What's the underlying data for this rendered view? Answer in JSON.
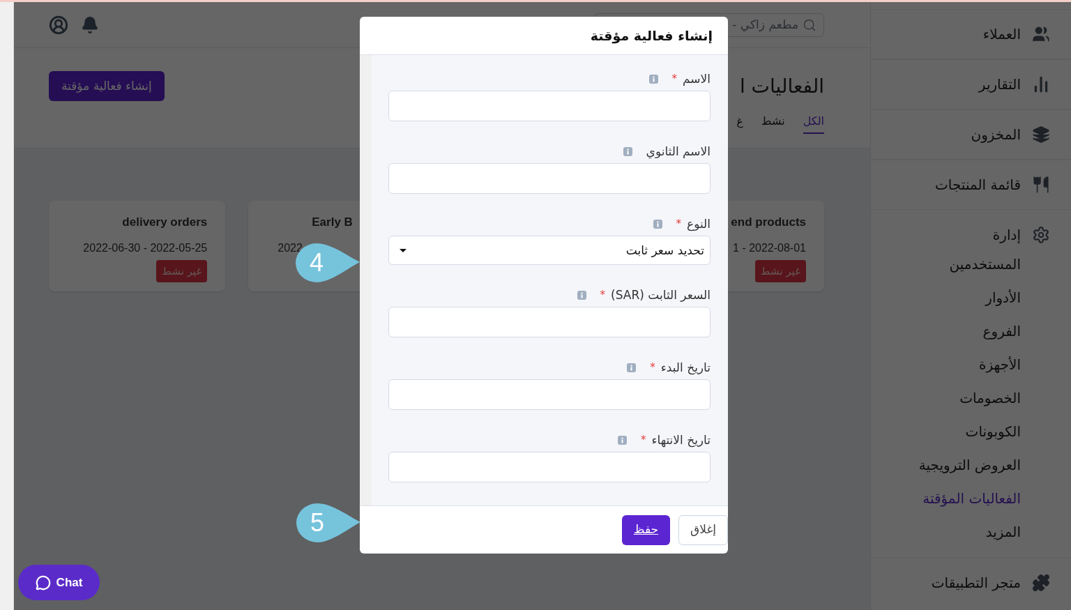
{
  "topbar": {
    "search_text": "مطعم زاكي -"
  },
  "header": {
    "title": "الفعاليات ا",
    "create_button": "إنشاء فعالية مؤقتة"
  },
  "tabs": [
    {
      "label": "الكل",
      "selected": true
    },
    {
      "label": "نشط",
      "selected": false
    },
    {
      "label": "غ",
      "selected": false
    }
  ],
  "cards": [
    {
      "title": "end products",
      "dates": "1 - 2022-08-01",
      "status": "غير نشط"
    },
    {
      "title": "Early B",
      "dates": "2022"
    },
    {
      "title": "delivery orders",
      "dates": "2022-06-30 - 2022-05-25",
      "status": "غير نشط"
    }
  ],
  "sidebar": {
    "items": [
      "العملاء",
      "التقارير",
      "المخزون",
      "قائمة المنتجات"
    ],
    "admin": {
      "label": "إدارة",
      "children": [
        {
          "label": "المستخدمين",
          "selected": false
        },
        {
          "label": "الأدوار",
          "selected": false
        },
        {
          "label": "الفروع",
          "selected": false
        },
        {
          "label": "الأجهزة",
          "selected": false
        },
        {
          "label": "الخصومات",
          "selected": false
        },
        {
          "label": "الكوبونات",
          "selected": false
        },
        {
          "label": "العروض الترويجية",
          "selected": false
        },
        {
          "label": "الفعاليات المؤقتة",
          "selected": true
        },
        {
          "label": "المزيد",
          "selected": false
        }
      ]
    },
    "app_store": "متجر التطبيقات"
  },
  "modal": {
    "title": "إنشاء فعالية مؤقتة",
    "fields": [
      {
        "label": "الاسم",
        "required_mark": "*",
        "kind": "text"
      },
      {
        "label": "الاسم الثانوي",
        "kind": "text"
      },
      {
        "label": "النوع",
        "required_mark": "*",
        "kind": "select",
        "value": "تحديد سعر ثابت"
      },
      {
        "label": "السعر الثابت (SAR)",
        "required_mark": "*",
        "kind": "text"
      },
      {
        "label": "تاريخ البدء",
        "required_mark": "*",
        "kind": "text"
      },
      {
        "label": "تاريخ الانتهاء",
        "required_mark": "*",
        "kind": "text"
      }
    ],
    "save_button": "حفظ",
    "close_button": "إغلاق"
  },
  "callouts": [
    {
      "number": "4"
    },
    {
      "number": "5"
    }
  ],
  "chat": {
    "label": "Chat"
  }
}
